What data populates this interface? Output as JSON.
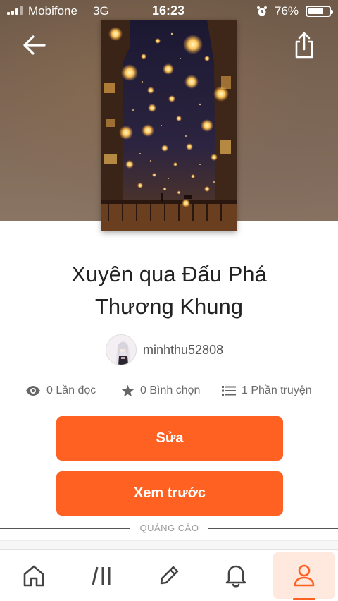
{
  "status_bar": {
    "carrier": "Mobifone",
    "network": "3G",
    "time": "16:23",
    "battery_percent": "76%",
    "battery_level": 0.76
  },
  "header": {
    "back_icon": "arrow-left-icon",
    "share_icon": "share-icon"
  },
  "story": {
    "title_line1": "Xuyên qua Đấu Phá",
    "title_line2": "Thương Khung",
    "author": "minhthu52808"
  },
  "stats": {
    "reads": "0 Lần đọc",
    "votes": "0 Bình chọn",
    "parts": "1 Phần truyện"
  },
  "actions": {
    "edit_label": "Sửa",
    "preview_label": "Xem trước"
  },
  "ad": {
    "label": "QUẢNG CÁO"
  },
  "bottom_nav": {
    "items": [
      "home-icon",
      "library-icon",
      "pencil-icon",
      "bell-icon",
      "profile-icon"
    ],
    "active": "profile-icon"
  },
  "colors": {
    "accent": "#ff6122",
    "active_tab_bg": "#ffe8dd"
  }
}
